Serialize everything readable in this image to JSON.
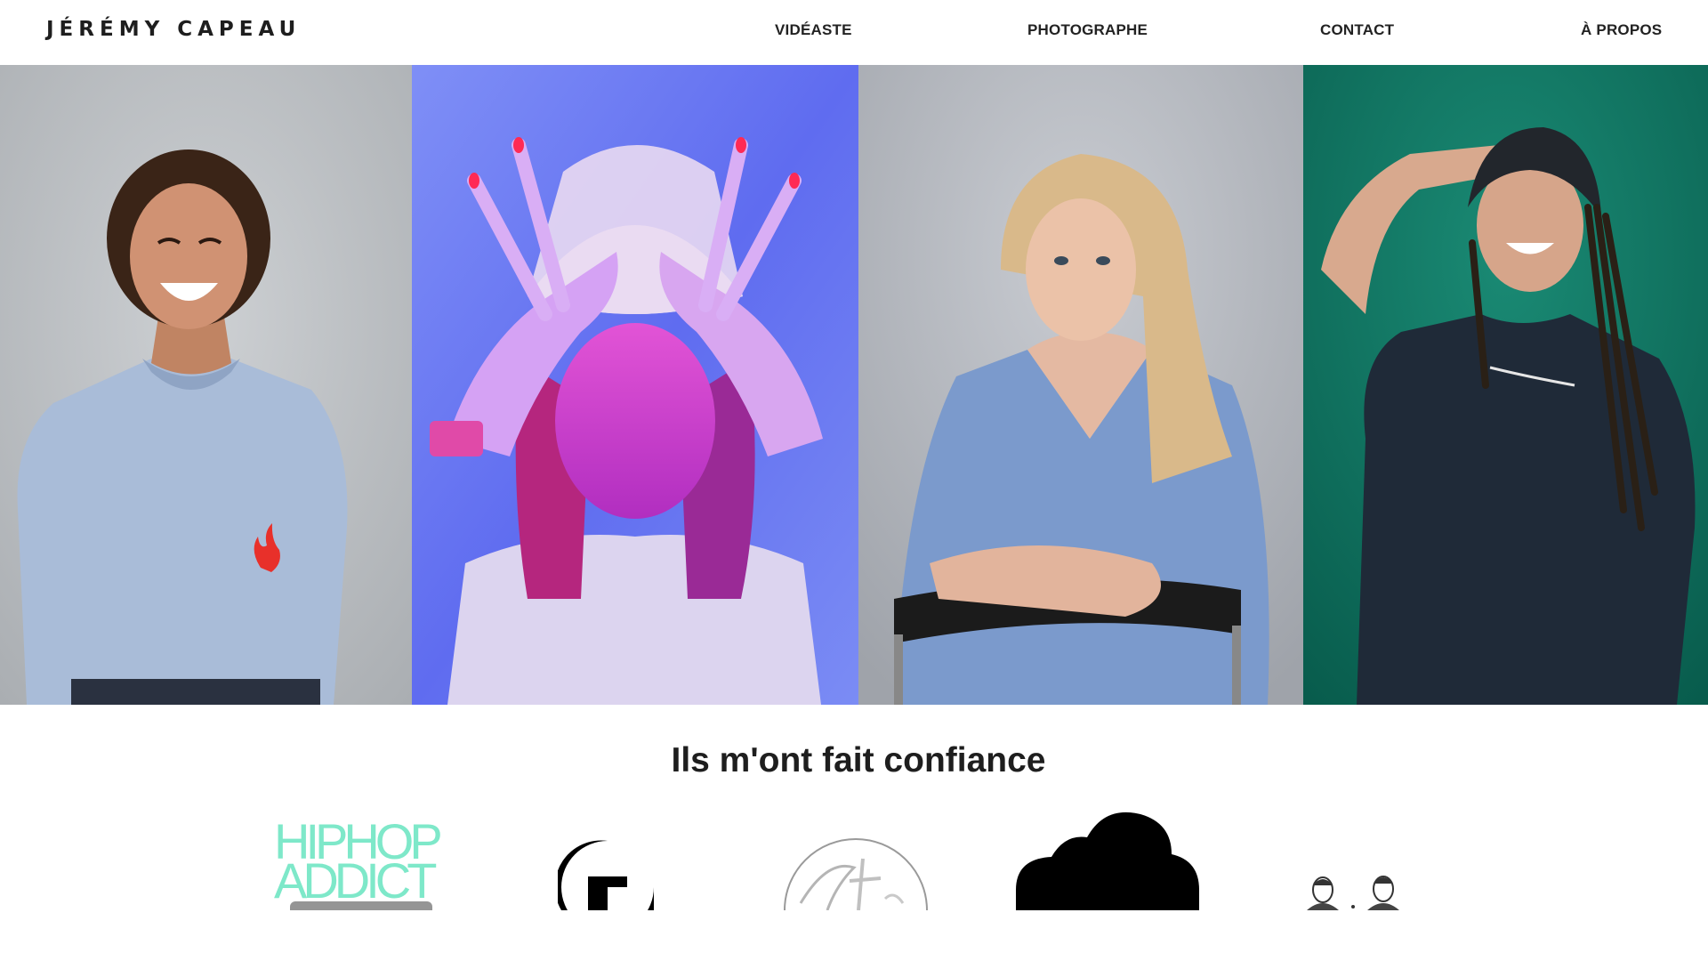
{
  "header": {
    "logo": "JÉRÉMY CAPEAU",
    "nav": [
      "VIDÉASTE",
      "PHOTOGRAPHE",
      "CONTACT",
      "À PROPOS"
    ]
  },
  "gallery": {
    "photos": [
      {
        "name": "portrait-laughing-woman-light-blue-tshirt",
        "background": "#bfc2c5"
      },
      {
        "name": "portrait-woman-bandana-neon-purple",
        "background": "#6f7ef2"
      },
      {
        "name": "portrait-blonde-woman-blue-shirt-chair",
        "background": "#b9bcc2"
      },
      {
        "name": "portrait-woman-braids-beanie-green",
        "background": "#0f7a66"
      }
    ]
  },
  "clients": {
    "title": "Ils m'ont fait confiance",
    "logos": [
      {
        "name": "hiphop-addict-logo",
        "line1": "HIPHOP",
        "line2": "ADDICT",
        "color": "#7ee8c9"
      },
      {
        "name": "g-letter-logo"
      },
      {
        "name": "script-circle-logo"
      },
      {
        "name": "cloud-logo"
      },
      {
        "name": "portrait-illustrations-logo"
      }
    ]
  }
}
